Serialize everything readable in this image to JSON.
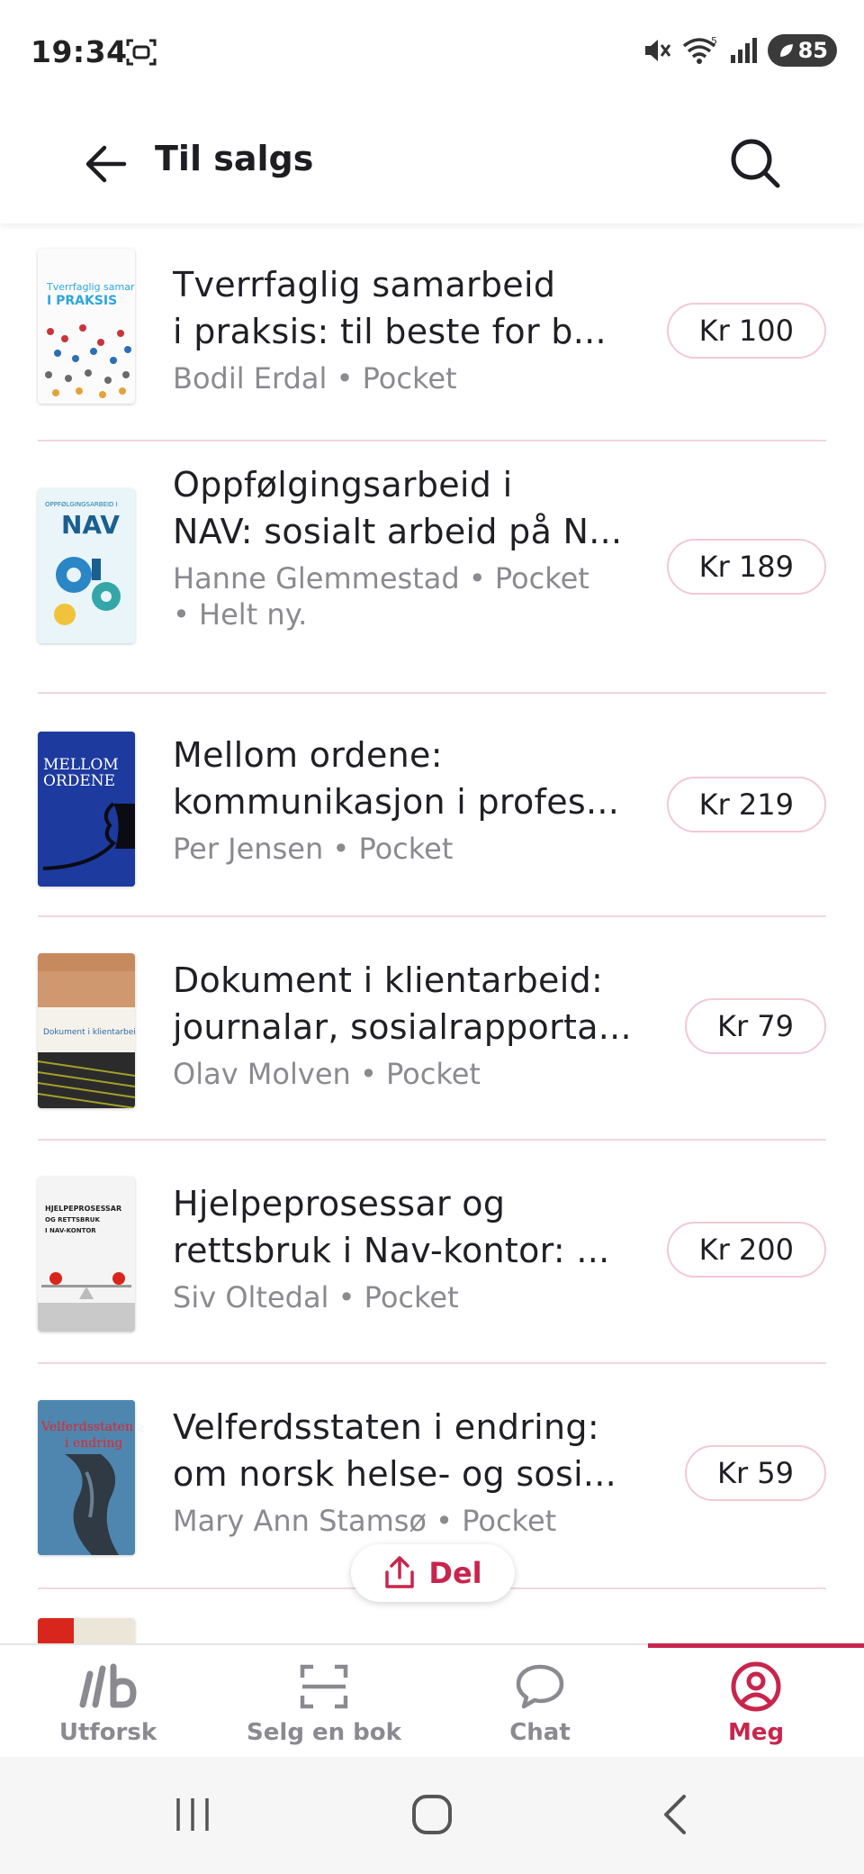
{
  "status_bar": {
    "time": "19:34",
    "battery": "85",
    "wifi_label": "5"
  },
  "header": {
    "title": "Til salgs"
  },
  "books": [
    {
      "title_line1": "Tverrfaglig samarbeid",
      "title_line2": "i praksis: til beste for b...",
      "meta_line1": "Bodil Erdal • Pocket",
      "meta_line2": "",
      "price": "Kr 100",
      "cover": {
        "bg": "#fbfbfb",
        "text": "Tverrfaglig samarbeid",
        "text2": "I PRAKSIS",
        "accent": "#2ea6df"
      }
    },
    {
      "title_line1": "Oppfølgingsarbeid i",
      "title_line2": "NAV: sosialt arbeid på N...",
      "meta_line1": "Hanne Glemmestad • Pocket",
      "meta_line2": "• Helt ny.",
      "price": "Kr 189",
      "cover": {
        "bg": "#e7f4f8",
        "text": "OPPFØLGINGSARBEID I",
        "text2": "NAV",
        "accent": "#1a7ab0"
      }
    },
    {
      "title_line1": "Mellom ordene:",
      "title_line2": "kommunikasjon i profes...",
      "meta_line1": "Per Jensen • Pocket",
      "meta_line2": "",
      "price": "Kr 219",
      "cover": {
        "bg": "#1d3a9e",
        "text": "MELLOM",
        "text2": "ORDENE",
        "accent": "#ffffff"
      }
    },
    {
      "title_line1": "Dokument i klientarbeid:",
      "title_line2": "journalar, sosialrapporta...",
      "meta_line1": "Olav Molven • Pocket",
      "meta_line2": "",
      "price": "Kr 79",
      "cover": {
        "bg": "#f3efe9",
        "text": "Dokument i klientarbeid",
        "text2": "",
        "accent": "#2b6aa6"
      }
    },
    {
      "title_line1": "Hjelpeprosessar og",
      "title_line2": "rettsbruk i Nav-kontor: ...",
      "meta_line1": "Siv Oltedal • Pocket",
      "meta_line2": "",
      "price": "Kr 200",
      "cover": {
        "bg": "#f1f1f1",
        "text": "HJELPEPROSESSAR",
        "text2": "OG RETTSBRUK I NAV-KONTOR",
        "accent": "#d8261c"
      }
    },
    {
      "title_line1": "Velferdsstaten i endring:",
      "title_line2": "om norsk helse- og sosi...",
      "meta_line1": "Mary Ann Stamsø • Pocket",
      "meta_line2": "",
      "price": "Kr 59",
      "cover": {
        "bg": "#3a6f95",
        "text": "Velferdsstaten",
        "text2": "i endring",
        "accent": "#e0262a"
      }
    }
  ],
  "share": {
    "label": "Del"
  },
  "bottom_nav": [
    {
      "label": "Utforsk",
      "icon": "brand-icon"
    },
    {
      "label": "Selg en bok",
      "icon": "scan-icon"
    },
    {
      "label": "Chat",
      "icon": "chat-icon"
    },
    {
      "label": "Meg",
      "icon": "profile-icon",
      "active": true
    }
  ],
  "colors": {
    "accent": "#c8254d",
    "divider": "#f3d6dd",
    "muted": "#8a8a8f"
  }
}
